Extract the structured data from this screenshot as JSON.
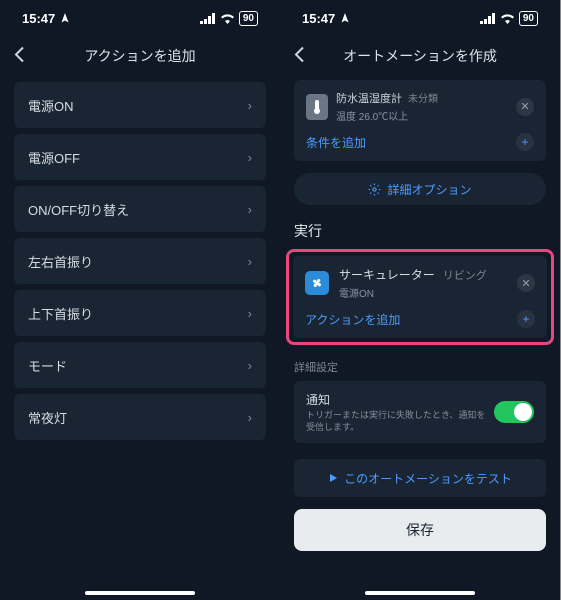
{
  "status": {
    "time": "15:47",
    "battery": "90"
  },
  "left": {
    "title": "アクションを追加",
    "items": [
      "電源ON",
      "電源OFF",
      "ON/OFF切り替え",
      "左右首振り",
      "上下首振り",
      "モード",
      "常夜灯"
    ]
  },
  "right": {
    "title": "オートメーションを作成",
    "condition": {
      "name": "防水温湿度計",
      "tag": "未分類",
      "detail": "温度 26.0℃以上"
    },
    "add_condition": "条件を追加",
    "options_btn": "詳細オプション",
    "exec_title": "実行",
    "exec": {
      "device": "サーキュレーター",
      "room": "リビング",
      "action": "電源ON"
    },
    "add_action": "アクションを追加",
    "detail_title": "詳細設定",
    "notify": {
      "title": "通知",
      "desc": "トリガーまたは実行に失敗したとき、通知を受信します。"
    },
    "test_btn": "このオートメーションをテスト",
    "save_btn": "保存"
  }
}
